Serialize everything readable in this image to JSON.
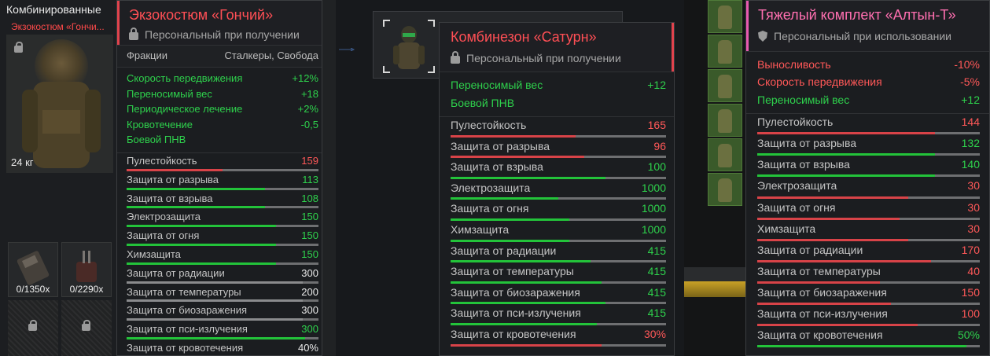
{
  "inventory": {
    "title": "Комбинированные",
    "subtitle": "Экзокостюм «Гончи...",
    "weight": "24 кг",
    "ammo": [
      "0/1350x",
      "0/2290x"
    ]
  },
  "card1": {
    "name": "Экзокостюм «Гончий»",
    "binding": "Персональный при получении",
    "factions_label": "Фракции",
    "factions_value": "Сталкеры, Свобода",
    "bonuses": [
      {
        "label": "Скорость передвижения",
        "value": "+12%"
      },
      {
        "label": "Переносимый вес",
        "value": "+18"
      },
      {
        "label": "Периодическое лечение",
        "value": "+2%"
      },
      {
        "label": "Кровотечение",
        "value": "-0,5"
      },
      {
        "label": "Боевой ПНВ",
        "value": ""
      }
    ],
    "stats": [
      {
        "label": "Пулестойкость",
        "value": "159",
        "tone": "r",
        "fill": 0.5
      },
      {
        "label": "Защита от разрыва",
        "value": "113",
        "tone": "g",
        "fill": 0.72
      },
      {
        "label": "Защита от взрыва",
        "value": "108",
        "tone": "g",
        "fill": 0.72
      },
      {
        "label": "Электрозащита",
        "value": "150",
        "tone": "g",
        "fill": 0.78
      },
      {
        "label": "Защита от огня",
        "value": "150",
        "tone": "g",
        "fill": 0.78
      },
      {
        "label": "Химзащита",
        "value": "150",
        "tone": "g",
        "fill": 0.78
      },
      {
        "label": "Защита от радиации",
        "value": "300",
        "tone": "w",
        "fill": 0.92
      },
      {
        "label": "Защита от температуры",
        "value": "200",
        "tone": "w",
        "fill": 0.92
      },
      {
        "label": "Защита от биозаражения",
        "value": "300",
        "tone": "w",
        "fill": 0.92
      },
      {
        "label": "Защита от пси-излучения",
        "value": "300",
        "tone": "g",
        "fill": 0.93
      },
      {
        "label": "Защита от кровотечения",
        "value": "40%",
        "tone": "w",
        "fill": 0.92
      }
    ]
  },
  "card2": {
    "name": "Комбинезон «Сатурн»",
    "binding": "Персональный при получении",
    "bonuses": [
      {
        "label": "Переносимый вес",
        "value": "+12"
      },
      {
        "label": "Боевой ПНВ",
        "value": ""
      }
    ],
    "stats": [
      {
        "label": "Пулестойкость",
        "value": "165",
        "tone": "r",
        "fill": 0.58
      },
      {
        "label": "Защита от разрыва",
        "value": "96",
        "tone": "r",
        "fill": 0.62
      },
      {
        "label": "Защита от взрыва",
        "value": "100",
        "tone": "g",
        "fill": 0.72
      },
      {
        "label": "Электрозащита",
        "value": "1000",
        "tone": "g",
        "fill": 0.5
      },
      {
        "label": "Защита от огня",
        "value": "1000",
        "tone": "g",
        "fill": 0.55
      },
      {
        "label": "Химзащита",
        "value": "1000",
        "tone": "g",
        "fill": 0.55
      },
      {
        "label": "Защита от радиации",
        "value": "415",
        "tone": "g",
        "fill": 0.65
      },
      {
        "label": "Защита от температуры",
        "value": "415",
        "tone": "g",
        "fill": 0.7
      },
      {
        "label": "Защита от биозаражения",
        "value": "415",
        "tone": "g",
        "fill": 0.72
      },
      {
        "label": "Защита от пси-излучения",
        "value": "415",
        "tone": "g",
        "fill": 0.68
      },
      {
        "label": "Защита от кровотечения",
        "value": "30%",
        "tone": "r",
        "fill": 0.7
      }
    ]
  },
  "card3": {
    "name": "Тяжелый комплект «Алтын-Т»",
    "binding": "Персональный при использовании",
    "bonuses": [
      {
        "label": "Выносливость",
        "value": "-10%",
        "tone": "r"
      },
      {
        "label": "Скорость передвижения",
        "value": "-5%",
        "tone": "r"
      },
      {
        "label": "Переносимый вес",
        "value": "+12",
        "tone": "g"
      }
    ],
    "stats": [
      {
        "label": "Пулестойкость",
        "value": "144",
        "tone": "r",
        "fill": 0.8
      },
      {
        "label": "Защита от разрыва",
        "value": "132",
        "tone": "g",
        "fill": 0.8
      },
      {
        "label": "Защита от взрыва",
        "value": "140",
        "tone": "g",
        "fill": 0.8
      },
      {
        "label": "Электрозащита",
        "value": "30",
        "tone": "r",
        "fill": 0.68
      },
      {
        "label": "Защита от огня",
        "value": "30",
        "tone": "r",
        "fill": 0.64
      },
      {
        "label": "Химзащита",
        "value": "30",
        "tone": "r",
        "fill": 0.68
      },
      {
        "label": "Защита от радиации",
        "value": "170",
        "tone": "r",
        "fill": 0.78
      },
      {
        "label": "Защита от температуры",
        "value": "40",
        "tone": "r",
        "fill": 0.55
      },
      {
        "label": "Защита от биозаражения",
        "value": "150",
        "tone": "r",
        "fill": 0.6
      },
      {
        "label": "Защита от пси-излучения",
        "value": "100",
        "tone": "r",
        "fill": 0.72
      },
      {
        "label": "Защита от кровотечения",
        "value": "50%",
        "tone": "g",
        "fill": 0.94
      }
    ]
  },
  "colors": {
    "title_red": "#ff4f55",
    "title_pink": "#ff6fb0",
    "accent_red_line": "#e0434d",
    "accent_pink_line": "#e85ab0",
    "green": "#2ed14c",
    "red": "#ff5858",
    "bar_green": "#23c33a",
    "bar_red": "#d84348"
  }
}
